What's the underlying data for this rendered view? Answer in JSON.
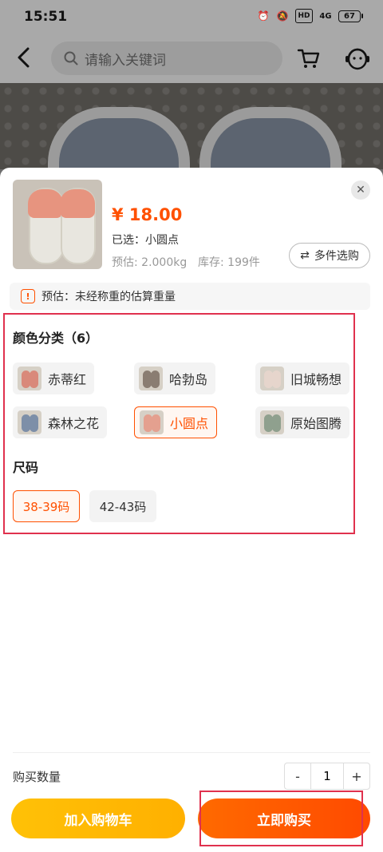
{
  "status_bar": {
    "time": "15:51",
    "battery": "67",
    "signal": "4G"
  },
  "header": {
    "search_placeholder": "请输入关键词"
  },
  "sku_panel": {
    "price": "¥ 18.00",
    "selected_text": "已选：小圆点",
    "weight_text": "预估: 2.000kg",
    "stock_text": "库存: 199件",
    "multi_select_label": "多件选购",
    "notice": "预估：未经称重的估算重量",
    "color_section_title": "颜色分类（6）",
    "colors": [
      {
        "label": "赤蒂红"
      },
      {
        "label": "哈勃岛"
      },
      {
        "label": "旧城畅想"
      },
      {
        "label": "森林之花"
      },
      {
        "label": "小圆点",
        "selected": true
      },
      {
        "label": "原始图腾"
      }
    ],
    "size_section_title": "尺码",
    "sizes": [
      {
        "label": "38-39码",
        "selected": true
      },
      {
        "label": "42-43码"
      }
    ],
    "quantity_label": "购买数量",
    "quantity_value": "1",
    "decrement_label": "-",
    "increment_label": "+",
    "add_to_cart_label": "加入购物车",
    "buy_now_label": "立即购买"
  },
  "colors": {
    "accent": "#ff5000",
    "highlight_frame": "#e0314e",
    "add_cart_bg": "#ffb000",
    "buy_now_bg": "#ff5a00"
  }
}
